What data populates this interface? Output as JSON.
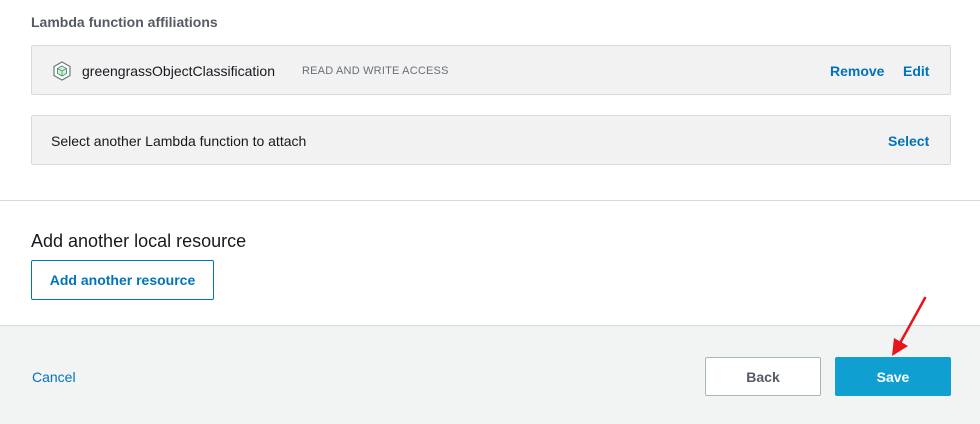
{
  "lambda_section": {
    "heading": "Lambda function affiliations",
    "functions": [
      {
        "name": "greengrassObjectClassification",
        "access": "READ AND WRITE ACCESS",
        "remove_label": "Remove",
        "edit_label": "Edit"
      }
    ],
    "attach_prompt": "Select another Lambda function to attach",
    "select_label": "Select"
  },
  "local_resource": {
    "title": "Add another local resource",
    "add_button_label": "Add another resource"
  },
  "footer": {
    "cancel_label": "Cancel",
    "back_label": "Back",
    "save_label": "Save"
  },
  "colors": {
    "link": "#0073bb",
    "primary_button": "#0f9fd0",
    "annotation_arrow": "#e8141a"
  },
  "icons": {
    "lambda": "lambda-cube-icon",
    "annotation": "red-arrow-icon"
  }
}
